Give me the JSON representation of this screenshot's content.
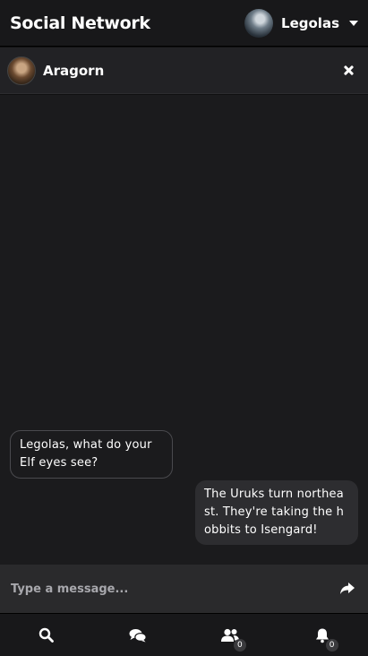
{
  "topbar": {
    "brand": "Social Network",
    "user_name": "Legolas"
  },
  "chat": {
    "contact_name": "Aragorn",
    "messages": [
      {
        "direction": "incoming",
        "text": "Legolas, what do your Elf eyes see?"
      },
      {
        "direction": "outgoing",
        "text": "The Uruks turn northea st. They're taking the h obbits to Isengard!"
      }
    ]
  },
  "composer": {
    "placeholder": "Type a message..."
  },
  "bottom_nav": {
    "items": [
      {
        "icon": "search-icon"
      },
      {
        "icon": "chat-icon"
      },
      {
        "icon": "friends-icon",
        "badge": "0"
      },
      {
        "icon": "bell-icon",
        "badge": "0"
      }
    ]
  },
  "colors": {
    "background": "#1b1b1d",
    "header": "#18181a",
    "bubble_out": "#2d2d30",
    "bubble_in_border": "#4a4a4e"
  }
}
